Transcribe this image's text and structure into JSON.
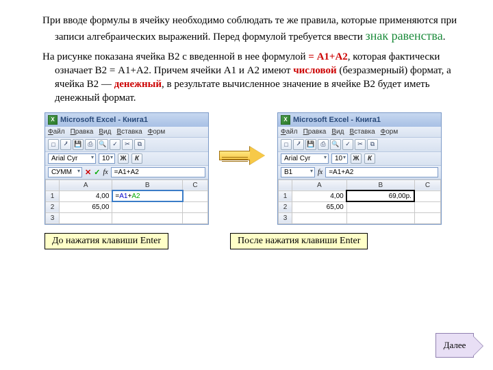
{
  "para1": {
    "t1": "При вводе формулы в ячейку необходимо соблюдать те же правила, которые применяются при записи алгебраических выражений. Перед формулой требуется ввести ",
    "t2": "знак равенства",
    "t3": "."
  },
  "para2": {
    "t1": "На рисунке показана ячейка В2 с введенной в нее формулой ",
    "t2": "= А1+А2",
    "t3": ", которая фактически означает В2 = А1+А2. Причем ячейки А1 и А2 имеют ",
    "t4": "числовой",
    "t5": " (безразмерный) формат, а ячейка В2 — ",
    "t6": "денежный",
    "t7": ", в результате вычисленное значение в ячейке В2 будет иметь денежный формат."
  },
  "excel": {
    "title": "Microsoft Excel - Книга1",
    "menus": [
      "Файл",
      "Правка",
      "Вид",
      "Вставка",
      "Форм"
    ],
    "font": "Arial Cyr",
    "fontsize": "10",
    "bold": "Ж",
    "italic": "К",
    "fx": "fx",
    "before": {
      "namebox": "СУММ",
      "cancel": "✕",
      "enter": "✓",
      "formula": "=A1+A2",
      "cells": {
        "a1": "4,00",
        "a2": "65,00",
        "b1_eq": "=",
        "b1_a1": "A1",
        "b1_plus": "+",
        "b1_a2": "A2"
      }
    },
    "after": {
      "namebox": "B1",
      "formula": "=A1+A2",
      "cells": {
        "a1": "4,00",
        "a2": "65,00",
        "b1": "69,00р."
      }
    },
    "cols": [
      "A",
      "B",
      "C"
    ],
    "rows": [
      "1",
      "2",
      "3"
    ]
  },
  "captions": {
    "before": "До нажатия клавиши Enter",
    "after": "После нажатия клавиши Enter"
  },
  "next": "Далее"
}
